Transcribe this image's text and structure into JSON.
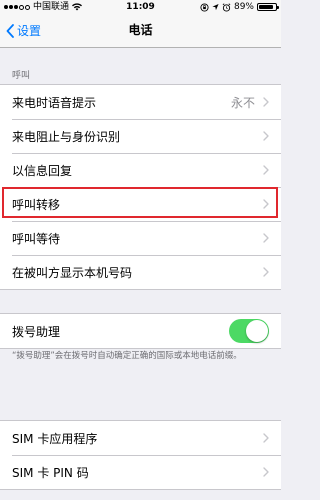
{
  "status_bar": {
    "carrier": "中国联通",
    "time": "11:09",
    "battery_text": "89%",
    "battery_level": 0.89
  },
  "nav": {
    "back_label": "设置",
    "title": "电话"
  },
  "call_section": {
    "header": "呼叫",
    "rows": [
      {
        "label": "来电时语音提示",
        "value": "永不"
      },
      {
        "label": "来电阻止与身份识别"
      },
      {
        "label": "以信息回复"
      },
      {
        "label": "呼叫转移"
      },
      {
        "label": "呼叫等待"
      },
      {
        "label": "在被叫方显示本机号码"
      }
    ]
  },
  "dial_assist": {
    "label": "拨号助理",
    "enabled": true,
    "footer": "“拨号助理”会在拨号时自动确定正确的国际或本地电话前缀。"
  },
  "sim_section": {
    "rows": [
      {
        "label": "SIM 卡应用程序"
      },
      {
        "label": "SIM 卡 PIN 码"
      }
    ]
  },
  "colors": {
    "accent": "#007aff",
    "toggle_on": "#4cd964",
    "highlight": "#e0282e",
    "background": "#efeff4"
  }
}
